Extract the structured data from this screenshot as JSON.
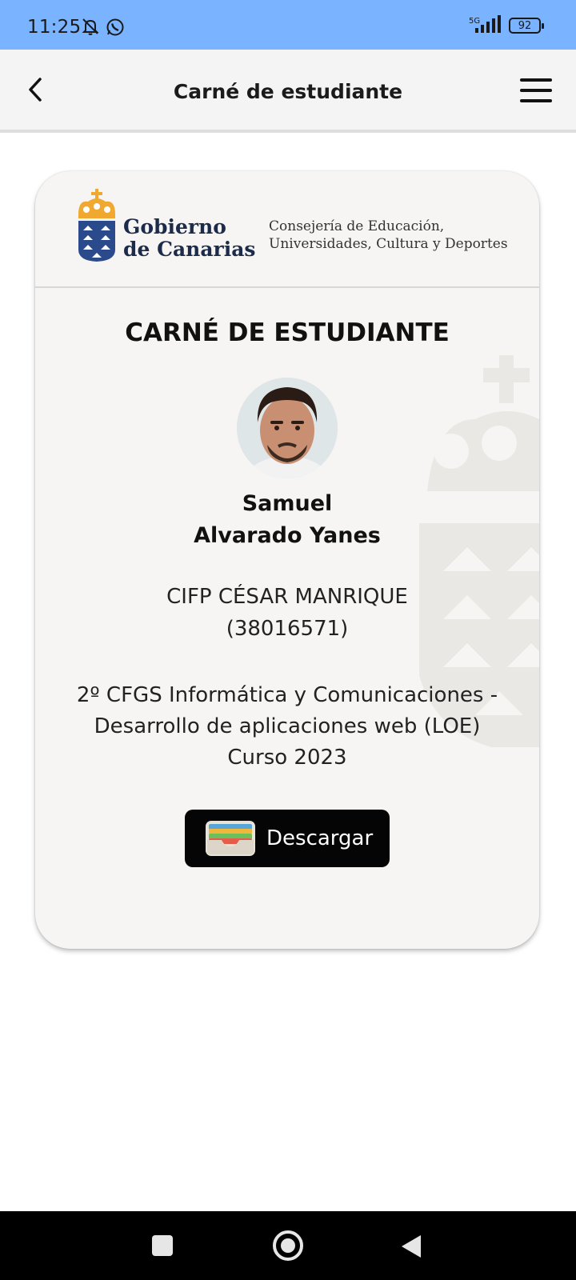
{
  "status_bar": {
    "time": "11:25",
    "network": "5G",
    "battery": "92",
    "icons": [
      "notifications-off-icon",
      "whatsapp-icon",
      "signal-icon",
      "battery-icon"
    ]
  },
  "header": {
    "title": "Carné de estudiante",
    "back_icon": "chevron-left-icon",
    "menu_icon": "hamburger-menu-icon"
  },
  "card": {
    "org": {
      "name_line1": "Gobierno",
      "name_line2": "de Canarias",
      "dept_line1": "Consejería de Educación,",
      "dept_line2": "Universidades, Cultura y Deportes"
    },
    "title": "CARNÉ DE ESTUDIANTE",
    "student": {
      "first_name": "Samuel",
      "last_name": "Alvarado Yanes"
    },
    "school": {
      "name": "CIFP CÉSAR MANRIQUE",
      "code": "(38016571)"
    },
    "course": {
      "line1": "2º CFGS Informática y Comunicaciones -",
      "line2": "Desarrollo de aplicaciones web (LOE)",
      "line3": "Curso 2023"
    },
    "download_button": {
      "label": "Descargar",
      "icon": "wallet-icon"
    }
  },
  "colors": {
    "status_bar": "#7ab3ff",
    "header_bg": "#f4f4f4",
    "card_bg": "#f6f5f3",
    "crest_blue": "#2a4a8c",
    "crest_gold": "#f0a830",
    "button_bg": "#050505"
  }
}
